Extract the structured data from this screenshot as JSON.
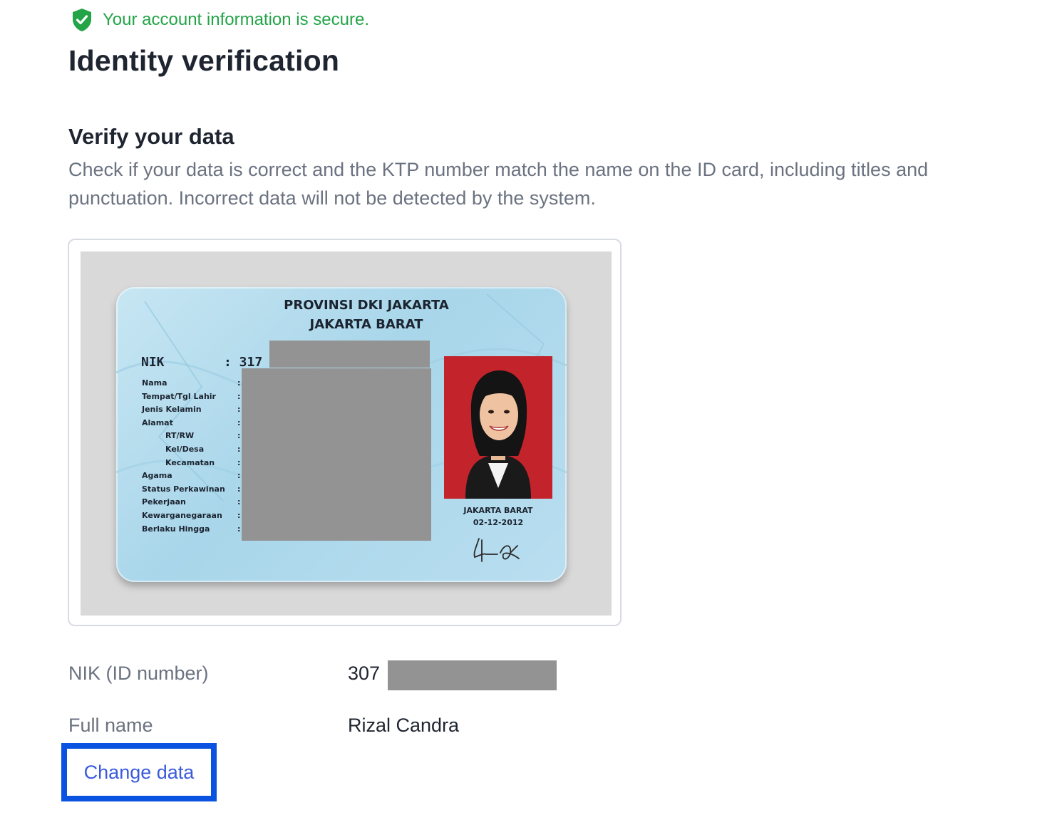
{
  "secure_notice": {
    "text": "Your account information is secure.",
    "icon": "shield-check-icon",
    "color": "#22a447"
  },
  "page_title": "Identity verification",
  "section": {
    "title": "Verify your data",
    "description": "Check if your data is correct and the KTP number match the name on the ID card, including titles and punctuation. Incorrect data will not be detected by the system."
  },
  "id_card": {
    "header_line1": "PROVINSI DKI JAKARTA",
    "header_line2": "JAKARTA BARAT",
    "nik_label": "NIK",
    "nik_value_visible": ": 317",
    "fields": [
      "Nama",
      "Tempat/Tgl Lahir",
      "Jenis Kelamin",
      "Alamat",
      "RT/RW",
      "Kel/Desa",
      "Kecamatan",
      "Agama",
      "Status Perkawinan",
      "Pekerjaan",
      "Kewarganegaraan",
      "Berlaku Hingga"
    ],
    "issue_city": "JAKARTA BARAT",
    "issue_date": "02-12-2012",
    "portrait_background": "#c3232a"
  },
  "details": {
    "nik_label": "NIK (ID number)",
    "nik_value_visible": "307",
    "fullname_label": "Full name",
    "fullname_value": "Rizal Candra"
  },
  "actions": {
    "change_data": "Change data",
    "link_color": "#3b5bdb",
    "highlight_color": "#0a52e0"
  }
}
